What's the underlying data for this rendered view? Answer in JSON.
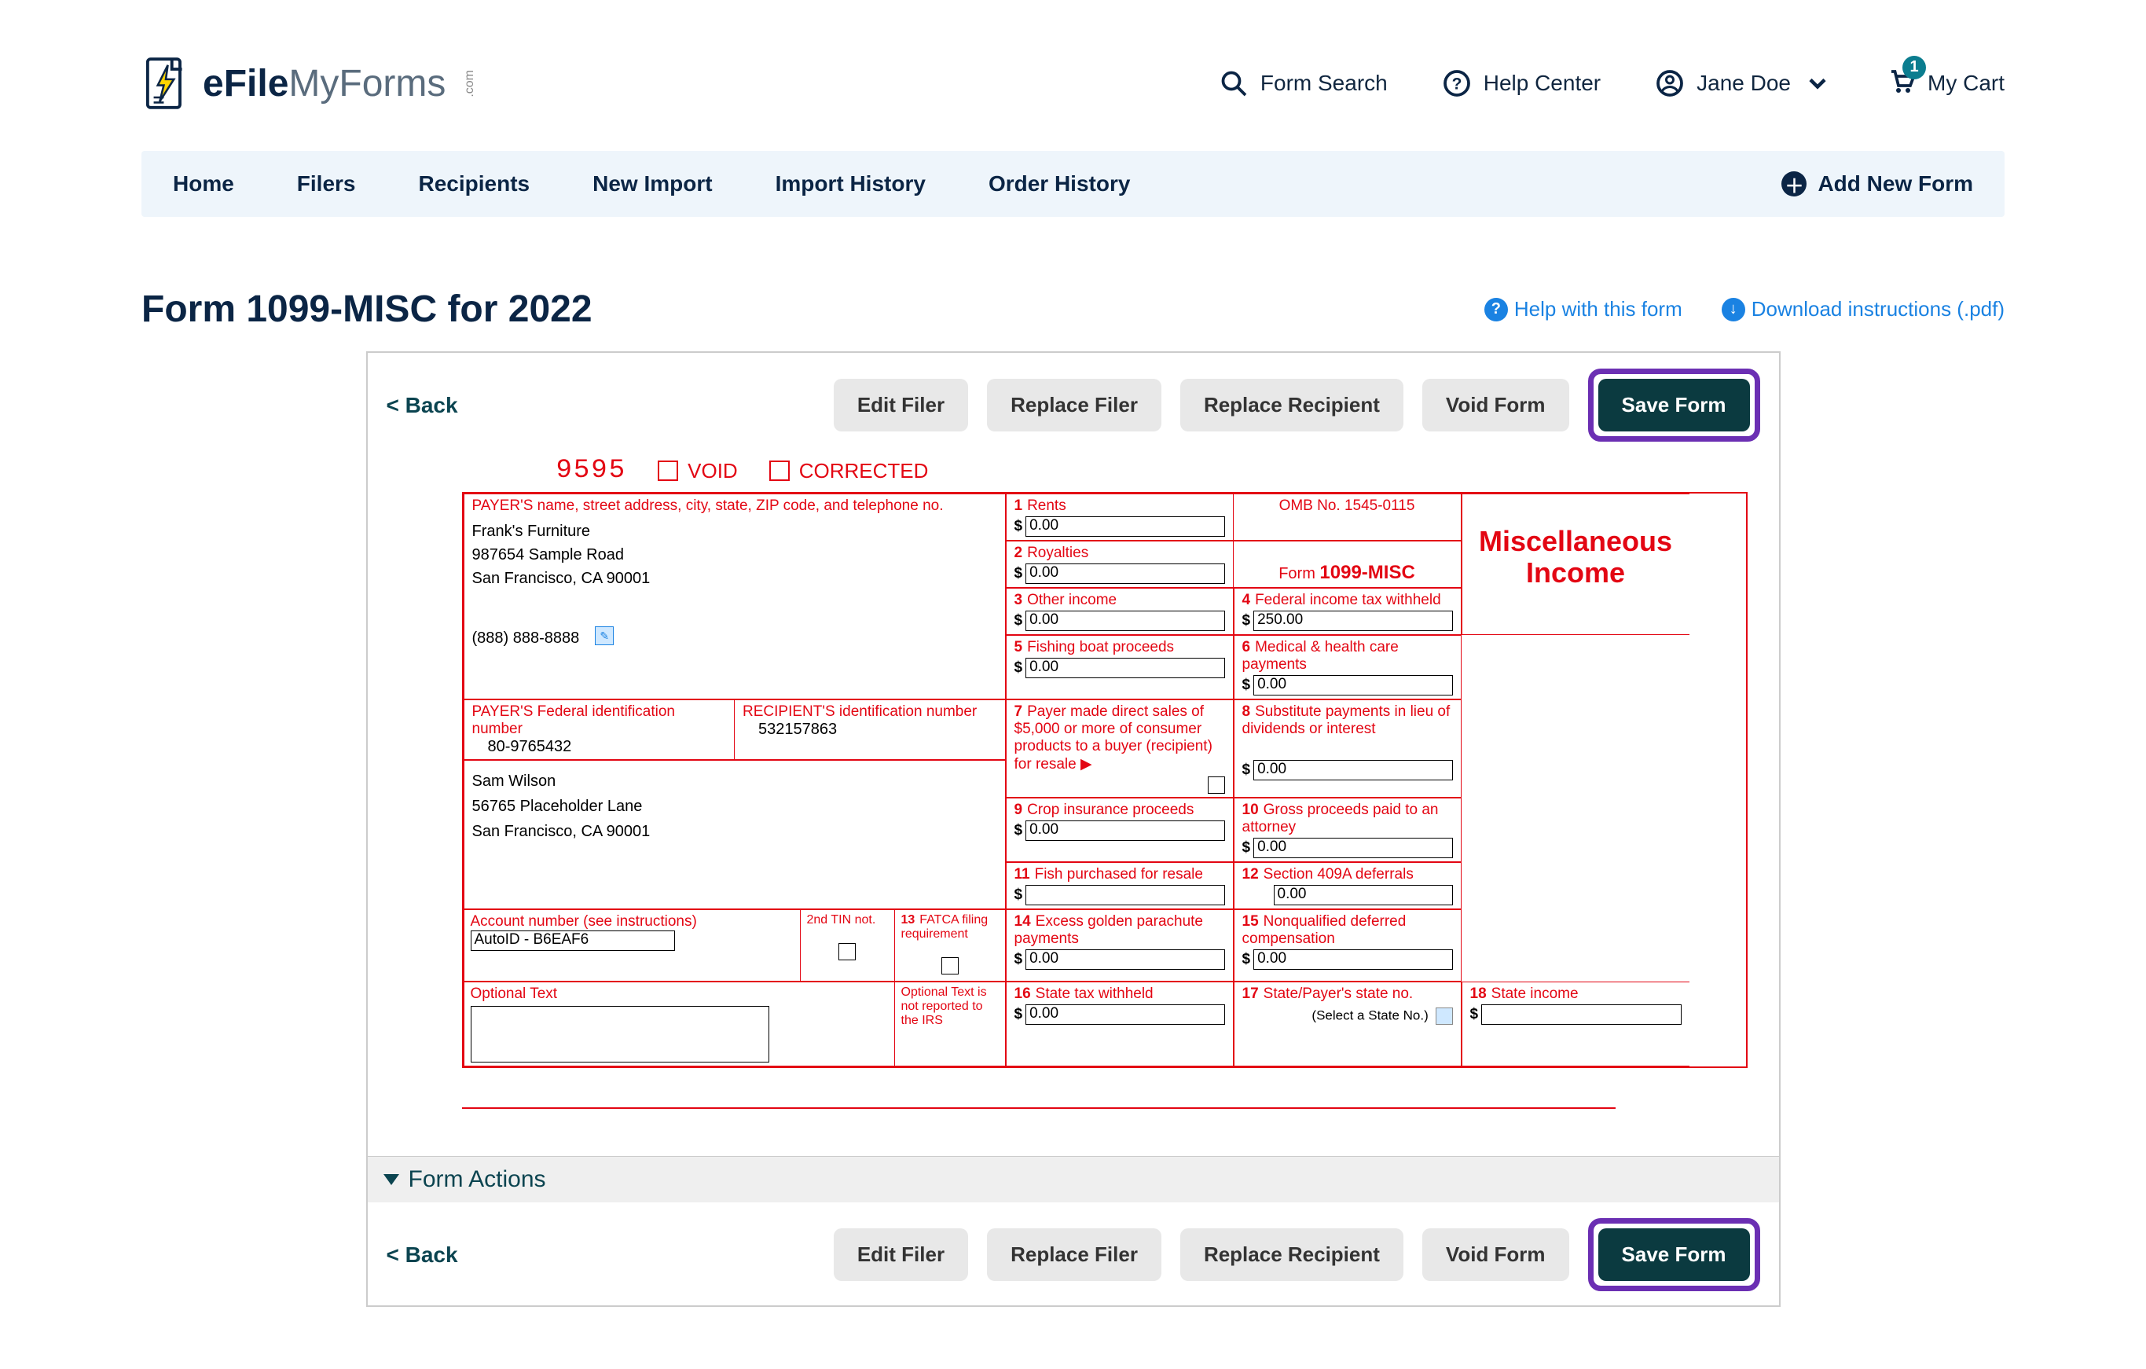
{
  "brand": {
    "part1": "eFile",
    "part2": "MyForms",
    "suffix": ".com"
  },
  "topbar": {
    "form_search": "Form Search",
    "help_center": "Help Center",
    "user_name": "Jane Doe",
    "my_cart": "My Cart",
    "cart_count": "1"
  },
  "nav": {
    "items": [
      "Home",
      "Filers",
      "Recipients",
      "New Import",
      "Import History",
      "Order History"
    ],
    "add_new_form": "Add New Form"
  },
  "page_title": "Form 1099-MISC for 2022",
  "title_links": {
    "help": "Help with this form",
    "download": "Download instructions (.pdf)"
  },
  "actions": {
    "back": "< Back",
    "edit_filer": "Edit Filer",
    "replace_filer": "Replace Filer",
    "replace_recipient": "Replace Recipient",
    "void_form": "Void Form",
    "save_form": "Save Form"
  },
  "form_header": {
    "code": "9595",
    "void": "VOID",
    "corrected": "CORRECTED"
  },
  "form": {
    "payer_label": "PAYER'S name, street address, city, state, ZIP code, and telephone no.",
    "payer_name": "Frank's Furniture",
    "payer_addr1": "987654 Sample Road",
    "payer_addr2": "San Francisco, CA 90001",
    "payer_phone": "(888) 888-8888",
    "payer_fedid_label": "PAYER'S Federal identification number",
    "payer_fedid": "80-9765432",
    "recipient_id_label": "RECIPIENT'S identification number",
    "recipient_id": "532157863",
    "recipient_name": "Sam Wilson",
    "recipient_addr1": "56765 Placeholder Lane",
    "recipient_addr2": "San Francisco, CA 90001",
    "account_label": "Account number (see instructions)",
    "account_value": "AutoID - B6EAF6",
    "second_tin_label": "2nd TIN not.",
    "fatca_label": "FATCA filing requirement",
    "optional_text_label": "Optional Text",
    "optional_text_not_reported": "Optional Text is not reported to the IRS",
    "omb": "OMB No. 1545-0115",
    "form_name_prefix": "Form ",
    "form_name": "1099-MISC",
    "big_title_line1": "Miscellaneous",
    "big_title_line2": "Income",
    "boxes": {
      "1": {
        "label": "Rents",
        "value": "0.00"
      },
      "2": {
        "label": "Royalties",
        "value": "0.00"
      },
      "3": {
        "label": "Other income",
        "value": "0.00"
      },
      "4": {
        "label": "Federal income tax withheld",
        "value": "250.00"
      },
      "5": {
        "label": "Fishing boat proceeds",
        "value": "0.00"
      },
      "6": {
        "label": "Medical & health care payments",
        "value": "0.00"
      },
      "7": {
        "label": "Payer made direct sales of $5,000 or more of consumer products to a buyer (recipient) for resale ▶"
      },
      "8": {
        "label": "Substitute payments in lieu of dividends or interest",
        "value": "0.00"
      },
      "9": {
        "label": "Crop insurance proceeds",
        "value": "0.00"
      },
      "10": {
        "label": "Gross proceeds paid to an attorney",
        "value": "0.00"
      },
      "11": {
        "label": "Fish purchased for resale",
        "value": ""
      },
      "12": {
        "label": "Section 409A deferrals",
        "value": "0.00"
      },
      "13": {
        "label_num": "13"
      },
      "14": {
        "label": "Excess golden parachute payments",
        "value": "0.00"
      },
      "15": {
        "label": "Nonqualified deferred compensation",
        "value": "0.00"
      },
      "16": {
        "label": "State tax withheld",
        "value": "0.00"
      },
      "17": {
        "label": "State/Payer's state no.",
        "placeholder": "(Select a State No.)"
      },
      "18": {
        "label": "State income",
        "value": ""
      }
    }
  },
  "form_actions_header": "Form Actions"
}
